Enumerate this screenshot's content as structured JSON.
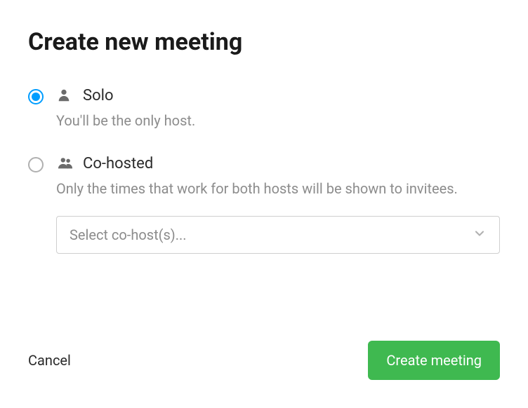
{
  "heading": "Create new meeting",
  "options": {
    "solo": {
      "label": "Solo",
      "description": "You'll be the only host."
    },
    "cohosted": {
      "label": "Co-hosted",
      "description": "Only the times that work for both hosts will be shown to invitees.",
      "select_placeholder": "Select co-host(s)..."
    }
  },
  "actions": {
    "cancel": "Cancel",
    "create": "Create meeting"
  }
}
